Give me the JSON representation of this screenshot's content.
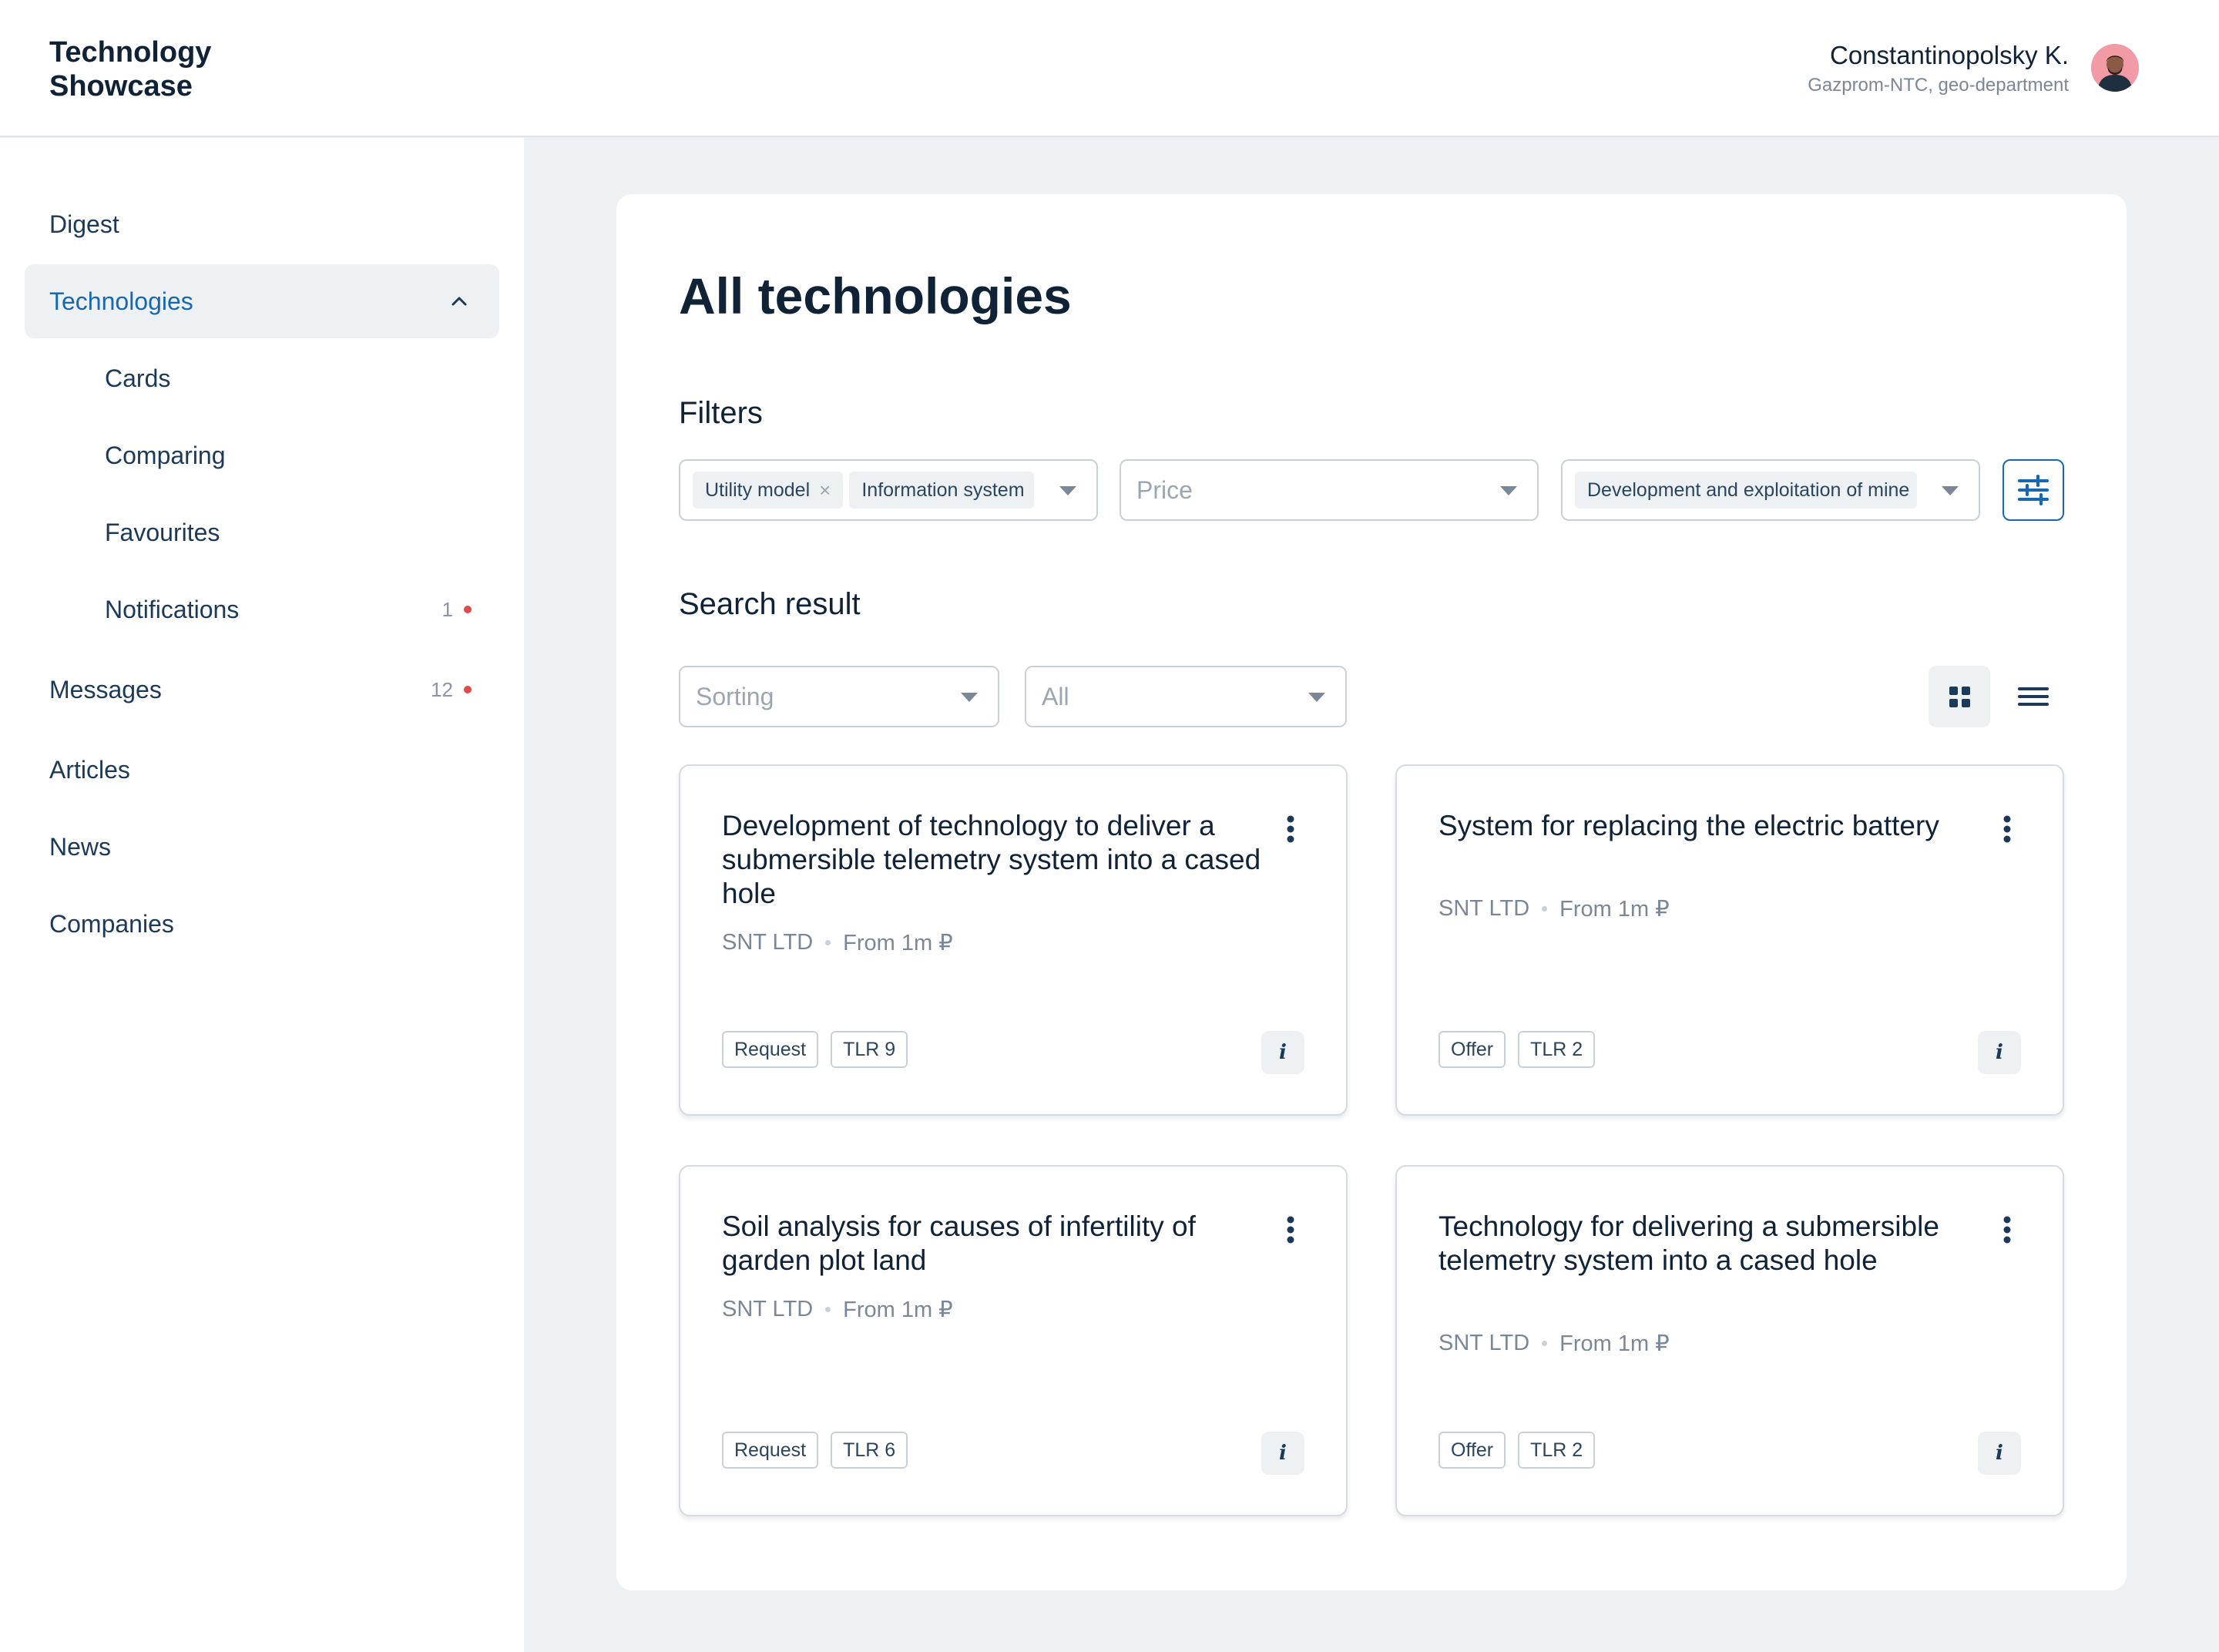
{
  "app": {
    "logo": "Technology\nShowcase"
  },
  "user": {
    "name": "Constantinopolsky K.",
    "org": "Gazprom-NTC, geo-department"
  },
  "sidebar": {
    "items": [
      {
        "label": "Digest"
      },
      {
        "label": "Technologies"
      },
      {
        "label": "Cards"
      },
      {
        "label": "Comparing"
      },
      {
        "label": "Favourites"
      },
      {
        "label": "Notifications",
        "badge": "1"
      },
      {
        "label": "Messages",
        "badge": "12"
      },
      {
        "label": "Articles"
      },
      {
        "label": "News"
      },
      {
        "label": "Companies"
      }
    ]
  },
  "main": {
    "title": "All technologies",
    "filters_label": "Filters",
    "filters": {
      "type_chips": [
        "Utility model",
        "Information system"
      ],
      "price_placeholder": "Price",
      "area_chip": "Development and exploitation of mine"
    },
    "results_label": "Search result",
    "sorting_placeholder": "Sorting",
    "all_placeholder": "All",
    "cards": [
      {
        "title": "Development of technology to deliver a submersible telemetry system into a cased hole",
        "company": "SNT LTD",
        "price": "From 1m ₽",
        "tags": [
          "Request",
          "TLR 9"
        ]
      },
      {
        "title": "System for replacing the electric battery",
        "company": "SNT LTD",
        "price": "From 1m ₽",
        "tags": [
          "Offer",
          "TLR 2"
        ]
      },
      {
        "title": "Soil analysis for causes of infertility of garden plot land",
        "company": "SNT LTD",
        "price": "From 1m ₽",
        "tags": [
          "Request",
          "TLR 6"
        ]
      },
      {
        "title": "Technology for delivering a submersible telemetry system into a cased hole",
        "company": "SNT LTD",
        "price": "From 1m ₽",
        "tags": [
          "Offer",
          "TLR 2"
        ]
      }
    ],
    "info_glyph": "i"
  },
  "colors": {
    "accent": "#1668b3",
    "text": "#0f2236",
    "muted": "#7a8796",
    "background": "#eef1f4",
    "notification_dot": "#e04a4a"
  },
  "icons": [
    "chevron-up-icon",
    "filter-settings-icon",
    "grid-view-icon",
    "list-view-icon",
    "more-vertical-icon",
    "info-icon",
    "close-icon",
    "caret-down-icon"
  ]
}
